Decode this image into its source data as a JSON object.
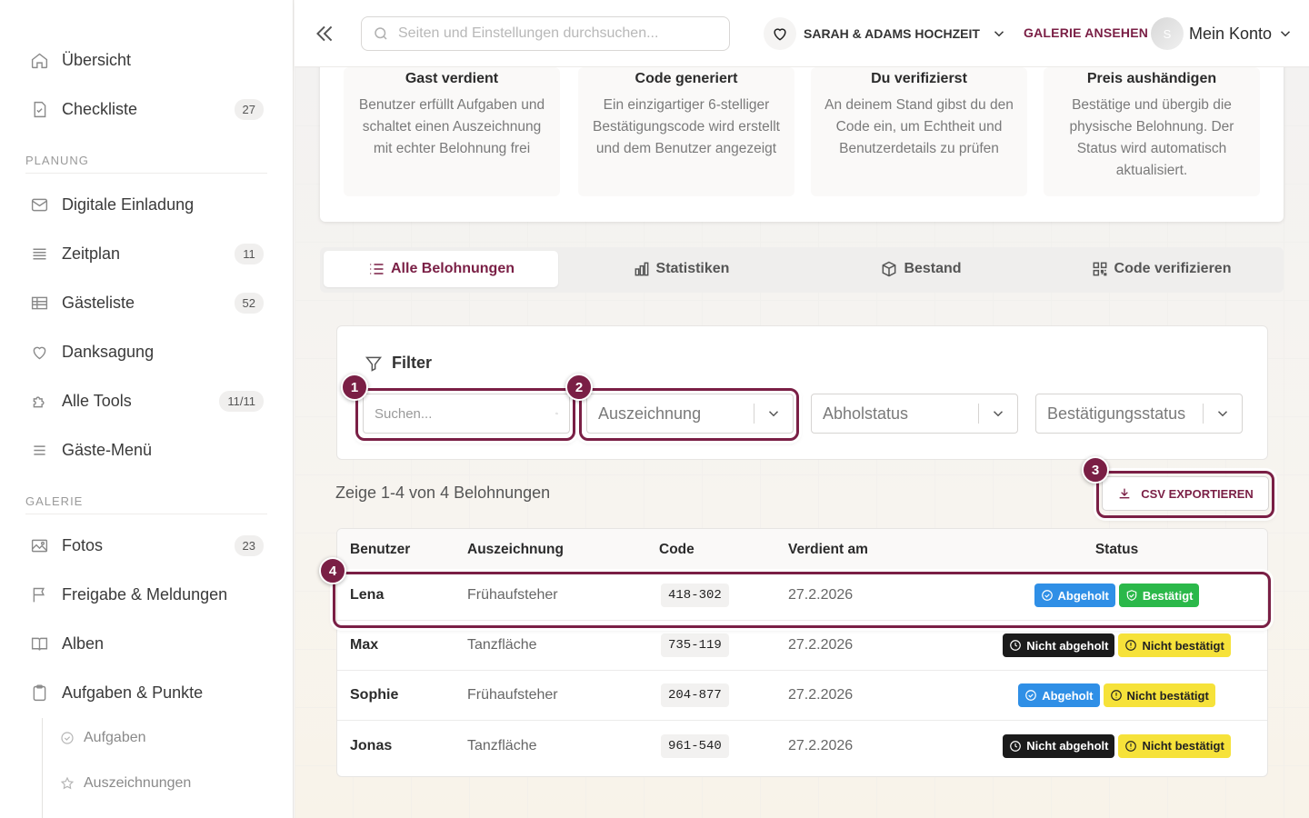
{
  "sidebar": {
    "items": [
      {
        "label": "Übersicht",
        "icon": "home-icon",
        "badge": ""
      },
      {
        "label": "Checkliste",
        "icon": "checklist-icon",
        "badge": "27"
      }
    ],
    "planning_label": "PLANUNG",
    "planning": [
      {
        "label": "Digitale Einladung",
        "icon": "mail-icon",
        "badge": ""
      },
      {
        "label": "Zeitplan",
        "icon": "timeline-icon",
        "badge": "11"
      },
      {
        "label": "Gästeliste",
        "icon": "table-icon",
        "badge": "52"
      },
      {
        "label": "Danksagung",
        "icon": "heart-icon",
        "badge": ""
      },
      {
        "label": "Alle Tools",
        "icon": "puzzle-icon",
        "badge": "11/11"
      },
      {
        "label": "Gäste-Menü",
        "icon": "menu-icon",
        "badge": ""
      }
    ],
    "gallery_label": "GALERIE",
    "gallery": [
      {
        "label": "Fotos",
        "icon": "image-icon",
        "badge": "23"
      },
      {
        "label": "Freigabe & Meldungen",
        "icon": "flag-icon",
        "badge": ""
      },
      {
        "label": "Alben",
        "icon": "book-icon",
        "badge": ""
      },
      {
        "label": "Aufgaben & Punkte",
        "icon": "clipboard-icon",
        "badge": ""
      }
    ],
    "sub": [
      {
        "label": "Aufgaben",
        "icon": "check-circle-icon"
      },
      {
        "label": "Auszeichnungen",
        "icon": "star-icon"
      }
    ]
  },
  "header": {
    "search_placeholder": "Seiten und Einstellungen durchsuchen...",
    "event_name": "SARAH & ADAMS HOCHZEIT",
    "gallery_link": "GALERIE ANSEHEN",
    "avatar_initial": "S",
    "account_label": "Mein Konto"
  },
  "steps": [
    {
      "title": "Gast verdient",
      "desc": "Benutzer erfüllt Aufgaben und schaltet einen Auszeichnung mit echter Belohnung frei"
    },
    {
      "title": "Code generiert",
      "desc": "Ein einzigartiger 6-stelliger Bestätigungscode wird erstellt und dem Benutzer angezeigt"
    },
    {
      "title": "Du verifizierst",
      "desc": "An deinem Stand gibst du den Code ein, um Echtheit und Benutzerdetails zu prüfen"
    },
    {
      "title": "Preis aushändigen",
      "desc": "Bestätige und übergib die physische Belohnung. Der Status wird automatisch aktualisiert."
    }
  ],
  "tabs": [
    {
      "label": "Alle Belohnungen",
      "icon": "list-icon"
    },
    {
      "label": "Statistiken",
      "icon": "bar-chart-icon"
    },
    {
      "label": "Bestand",
      "icon": "box-icon"
    },
    {
      "label": "Code verifizieren",
      "icon": "qr-icon"
    }
  ],
  "filter": {
    "title": "Filter",
    "search_placeholder": "Suchen...",
    "selects": [
      "Auszeichnung",
      "Abholstatus",
      "Bestätigungsstatus"
    ]
  },
  "result_count": "Zeige 1-4 von 4 Belohnungen",
  "csv_label": "CSV EXPORTIEREN",
  "table": {
    "headers": [
      "Benutzer",
      "Auszeichnung",
      "Code",
      "Verdient am",
      "Status"
    ],
    "rows": [
      {
        "user": "Lena",
        "award": "Frühaufsteher",
        "code": "418-302",
        "date": "27.2.2026",
        "pickup": "Abgeholt",
        "confirm": "Bestätigt"
      },
      {
        "user": "Max",
        "award": "Tanzfläche",
        "code": "735-119",
        "date": "27.2.2026",
        "pickup": "Nicht abgeholt",
        "confirm": "Nicht bestätigt"
      },
      {
        "user": "Sophie",
        "award": "Frühaufsteher",
        "code": "204-877",
        "date": "27.2.2026",
        "pickup": "Abgeholt",
        "confirm": "Nicht bestätigt"
      },
      {
        "user": "Jonas",
        "award": "Tanzfläche",
        "code": "961-540",
        "date": "27.2.2026",
        "pickup": "Nicht abgeholt",
        "confirm": "Nicht bestätigt"
      }
    ]
  },
  "callouts": [
    "1",
    "2",
    "3",
    "4"
  ],
  "colors": {
    "brand": "#7a1f45",
    "blue": "#2f8fe6",
    "green": "#2bb84a",
    "black": "#1b1b1b",
    "yellow": "#f6e23a"
  }
}
